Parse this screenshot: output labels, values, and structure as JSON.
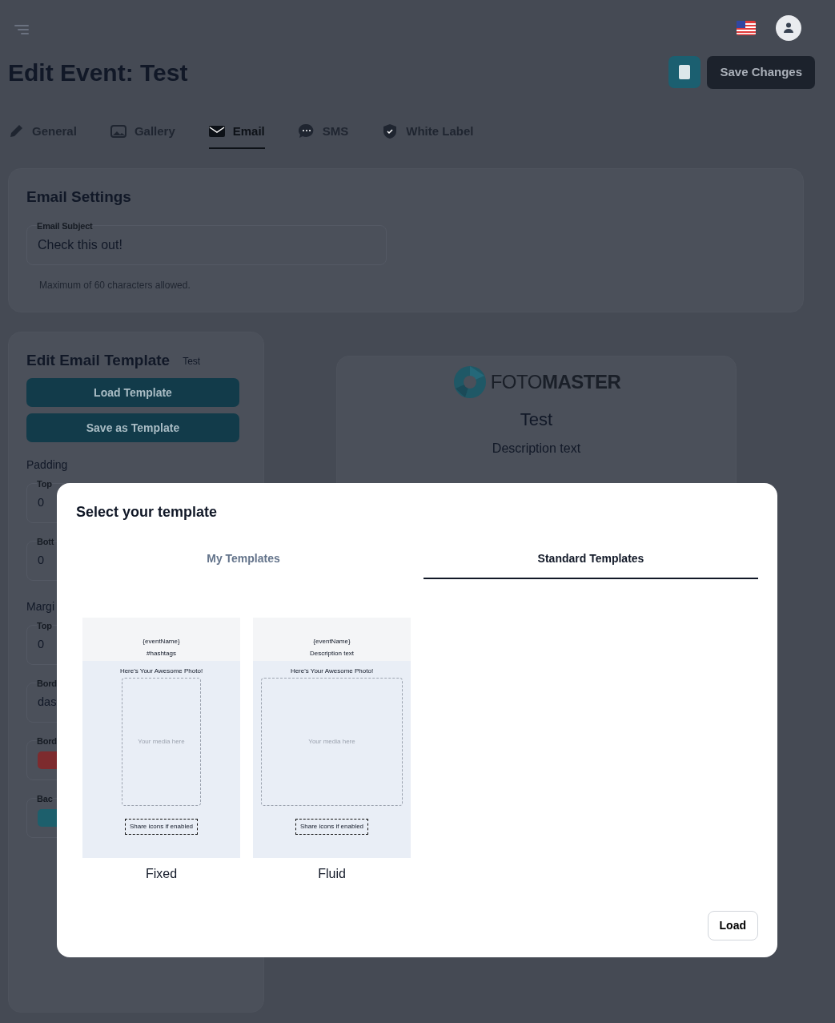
{
  "header": {
    "title": "Edit Event: Test",
    "save_button": "Save Changes"
  },
  "tabs": [
    {
      "label": "General",
      "selected": false
    },
    {
      "label": "Gallery",
      "selected": false
    },
    {
      "label": "Email",
      "selected": true
    },
    {
      "label": "SMS",
      "selected": false
    },
    {
      "label": "White Label",
      "selected": false
    }
  ],
  "email_settings": {
    "title": "Email Settings",
    "subject_label": "Email Subject",
    "subject_value": "Check this out!",
    "help": "Maximum of 60 characters allowed."
  },
  "template_editor": {
    "title": "Edit Email Template",
    "template_name": "Test",
    "buttons": [
      "Load Template",
      "Save as Template"
    ],
    "groups": [
      {
        "label": "Padding",
        "fields": [
          {
            "kind": "text",
            "label": "Top",
            "value": "0"
          },
          {
            "kind": "text",
            "label": "Bott",
            "value": "0"
          }
        ]
      },
      {
        "label": "Margi",
        "fields": [
          {
            "kind": "text",
            "label": "Top",
            "value": "0"
          },
          {
            "kind": "text",
            "label": "Bord",
            "value": "das"
          },
          {
            "kind": "color",
            "label": "Bord",
            "color": "#7d2b2e"
          },
          {
            "kind": "color",
            "label": "Bac",
            "color": "#1d5f6c"
          }
        ]
      }
    ]
  },
  "preview": {
    "logo_light": "FOTO",
    "logo_bold": "MASTER",
    "title": "Test",
    "description": "Description text"
  },
  "modal": {
    "title": "Select your template",
    "tabs": [
      {
        "label": "My Templates",
        "selected": false
      },
      {
        "label": "Standard Templates",
        "selected": true
      }
    ],
    "templates": [
      {
        "name": "Fixed",
        "kind": "fixed",
        "event_name": "{eventName}",
        "subtitle": "#hashtags",
        "heading": "Here's Your Awesome Photo!",
        "media": "Your media here",
        "share": "Share icons if enabled"
      },
      {
        "name": "Fluid",
        "kind": "fluid",
        "event_name": "{eventName}",
        "subtitle": "Description text",
        "heading": "Here's Your Awesome Photo!",
        "media": "Your media here",
        "share": "Share icons if enabled"
      }
    ],
    "load_button": "Load"
  }
}
